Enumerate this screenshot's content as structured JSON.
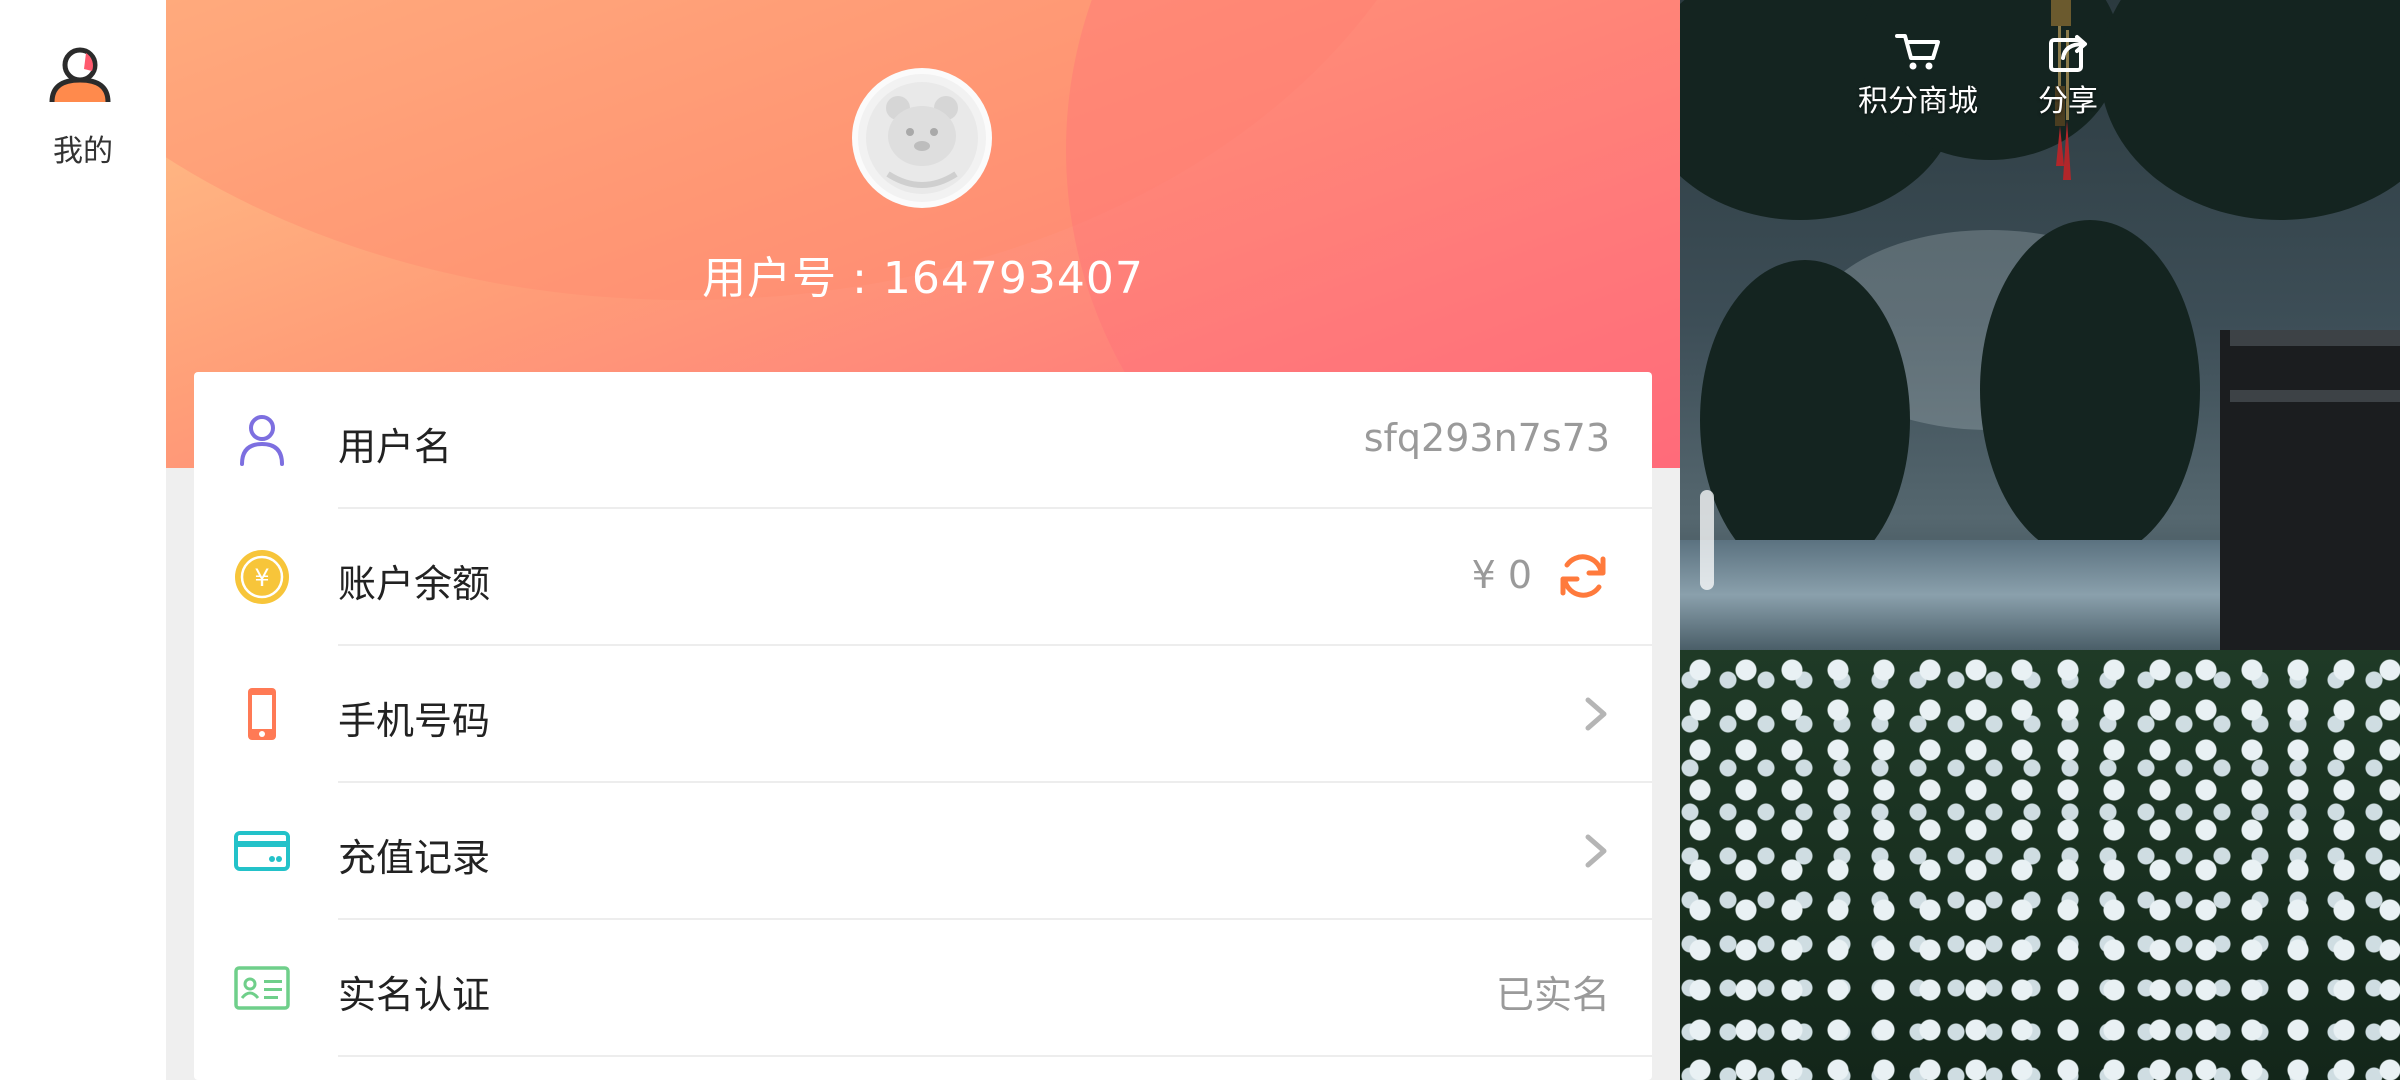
{
  "rail": {
    "tab_label": "我的"
  },
  "header": {
    "user_id_label": "用户号 : 164793407"
  },
  "rows": [
    {
      "label": "用户名",
      "value": "sfq293n7s73",
      "icon": "user-icon"
    },
    {
      "label": "账户余额",
      "value": "¥ 0",
      "icon": "yuan-coin-icon"
    },
    {
      "label": "手机号码",
      "value": "",
      "icon": "phone-icon"
    },
    {
      "label": "充值记录",
      "value": "",
      "icon": "card-icon"
    },
    {
      "label": "实名认证",
      "value": "已实名",
      "icon": "id-card-icon"
    }
  ],
  "top_buttons": {
    "shop_label": "积分商城",
    "share_label": "分享"
  },
  "colors": {
    "accent_orange": "#ff8a4c",
    "header_gradient_start": "#ffc388",
    "header_gradient_end": "#ff6a7b"
  }
}
